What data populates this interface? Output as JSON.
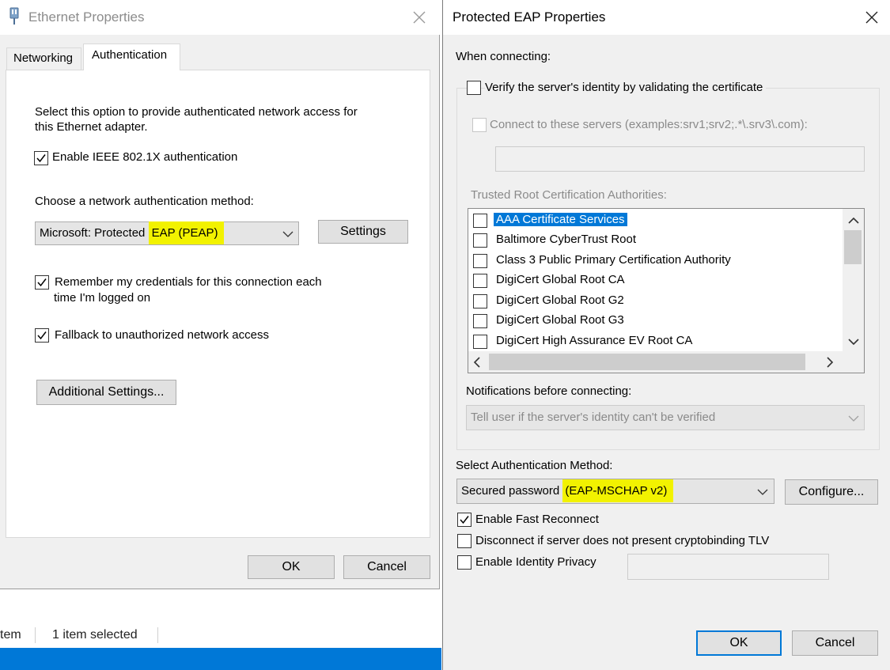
{
  "ethernet": {
    "title": "Ethernet Properties",
    "tabs": [
      "Networking",
      "Authentication"
    ],
    "description_line1": "Select this option to provide authenticated network access for",
    "description_line2": "this Ethernet adapter.",
    "enable_8021x": "Enable IEEE 802.1X authentication",
    "choose_method_label": "Choose a network authentication method:",
    "method_prefix": "Microsoft: Protected ",
    "method_highlight": "EAP (PEAP)",
    "settings_button": "Settings",
    "remember_line1": "Remember my credentials for this connection each",
    "remember_line2": "time I'm logged on",
    "fallback": "Fallback to unauthorized network access",
    "additional_settings_button": "Additional Settings...",
    "ok_button": "OK",
    "cancel_button": "Cancel",
    "checks": {
      "enable_8021x": true,
      "remember": true,
      "fallback": true
    }
  },
  "explorer_status": {
    "items_fragment": "tem",
    "selected": "1 item selected"
  },
  "peap": {
    "title": "Protected EAP Properties",
    "when_connecting": "When connecting:",
    "verify_server": "Verify the server's identity by validating the certificate",
    "connect_servers": "Connect to these servers (examples:srv1;srv2;.*\\.srv3\\.com):",
    "servers_value": "",
    "trusted_root_label": "Trusted Root Certification Authorities:",
    "cert_list": [
      "AAA Certificate Services",
      "Baltimore CyberTrust Root",
      "Class 3 Public Primary Certification Authority",
      "DigiCert Global Root CA",
      "DigiCert Global Root G2",
      "DigiCert Global Root G3",
      "DigiCert High Assurance EV Root CA"
    ],
    "notifications_label": "Notifications before connecting:",
    "notifications_value": "Tell user if the server's identity can't be verified",
    "select_auth_label": "Select Authentication Method:",
    "auth_prefix": "Secured password ",
    "auth_highlight": "(EAP-MSCHAP v2)",
    "configure_button": "Configure...",
    "fast_reconnect": "Enable Fast Reconnect",
    "disconnect_crypto": "Disconnect if server does not present cryptobinding TLV",
    "identity_privacy": "Enable Identity Privacy",
    "identity_value": "",
    "ok_button": "OK",
    "cancel_button": "Cancel",
    "checks": {
      "verify": false,
      "connect": false,
      "fast_reconnect": true,
      "disconnect": false,
      "identity": false
    }
  },
  "colors": {
    "highlight": "#f2f200",
    "selection": "#0078d7",
    "taskbar": "#0078d7",
    "disabled_text": "#8a8a8a"
  },
  "icons": [
    "network-adapter-icon",
    "close-icon",
    "checkmark-icon",
    "chevron-down-icon",
    "scroll-up-icon",
    "scroll-down-icon",
    "scroll-left-icon",
    "scroll-right-icon"
  ]
}
